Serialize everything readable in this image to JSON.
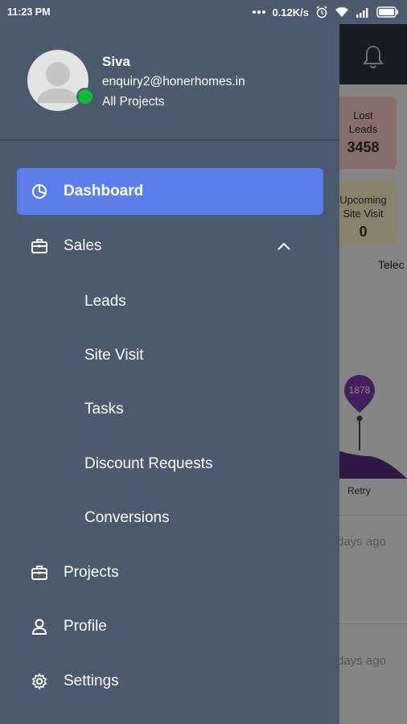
{
  "status_bar": {
    "time": "11:23 PM",
    "network_speed": "0.12K/s",
    "icons": [
      "more-dots-icon",
      "alarm-icon",
      "wifi-icon",
      "signal-icon",
      "battery-icon"
    ]
  },
  "background": {
    "cards": [
      {
        "label_line1": "Lost",
        "label_line2": "Leads",
        "value": "3458",
        "color": "#f6c7c4"
      },
      {
        "label_line1": "Upcoming",
        "label_line2": "Site Visit",
        "value": "0",
        "color": "#fbeec5"
      }
    ],
    "tele_label": "Telec",
    "chart_marker_value": "1878",
    "chart_axis_label": "Retry",
    "activity": [
      {
        "time": "days ago"
      },
      {
        "time": "days ago"
      }
    ]
  },
  "drawer": {
    "user": {
      "name": "Siva",
      "email": "enquiry2@honerhomes.in",
      "scope": "All Projects",
      "online": true
    },
    "nav": [
      {
        "label": "Dashboard",
        "icon": "pie-chart-icon",
        "active": true
      },
      {
        "label": "Sales",
        "icon": "briefcase-icon",
        "expanded": true,
        "children": [
          {
            "label": "Leads"
          },
          {
            "label": "Site Visit"
          },
          {
            "label": "Tasks"
          },
          {
            "label": "Discount Requests"
          },
          {
            "label": "Conversions"
          }
        ]
      },
      {
        "label": "Projects",
        "icon": "briefcase-icon"
      },
      {
        "label": "Profile",
        "icon": "user-icon"
      },
      {
        "label": "Settings",
        "icon": "gear-icon"
      }
    ]
  },
  "colors": {
    "drawer_bg": "#4c5a70",
    "active_item": "#5b7ee8",
    "online_dot": "#13b83a",
    "header_dark": "#2a3242"
  }
}
